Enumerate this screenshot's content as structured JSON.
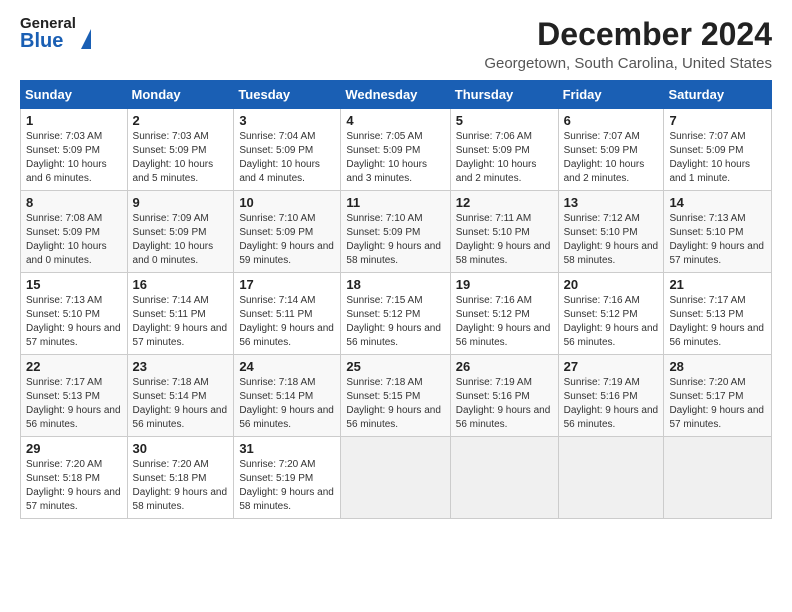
{
  "header": {
    "logo": {
      "general": "General",
      "blue": "Blue"
    },
    "month": "December 2024",
    "location": "Georgetown, South Carolina, United States"
  },
  "weekdays": [
    "Sunday",
    "Monday",
    "Tuesday",
    "Wednesday",
    "Thursday",
    "Friday",
    "Saturday"
  ],
  "weeks": [
    [
      {
        "day": "1",
        "sunrise": "7:03 AM",
        "sunset": "5:09 PM",
        "daylight": "10 hours and 6 minutes."
      },
      {
        "day": "2",
        "sunrise": "7:03 AM",
        "sunset": "5:09 PM",
        "daylight": "10 hours and 5 minutes."
      },
      {
        "day": "3",
        "sunrise": "7:04 AM",
        "sunset": "5:09 PM",
        "daylight": "10 hours and 4 minutes."
      },
      {
        "day": "4",
        "sunrise": "7:05 AM",
        "sunset": "5:09 PM",
        "daylight": "10 hours and 3 minutes."
      },
      {
        "day": "5",
        "sunrise": "7:06 AM",
        "sunset": "5:09 PM",
        "daylight": "10 hours and 2 minutes."
      },
      {
        "day": "6",
        "sunrise": "7:07 AM",
        "sunset": "5:09 PM",
        "daylight": "10 hours and 2 minutes."
      },
      {
        "day": "7",
        "sunrise": "7:07 AM",
        "sunset": "5:09 PM",
        "daylight": "10 hours and 1 minute."
      }
    ],
    [
      {
        "day": "8",
        "sunrise": "7:08 AM",
        "sunset": "5:09 PM",
        "daylight": "10 hours and 0 minutes."
      },
      {
        "day": "9",
        "sunrise": "7:09 AM",
        "sunset": "5:09 PM",
        "daylight": "10 hours and 0 minutes."
      },
      {
        "day": "10",
        "sunrise": "7:10 AM",
        "sunset": "5:09 PM",
        "daylight": "9 hours and 59 minutes."
      },
      {
        "day": "11",
        "sunrise": "7:10 AM",
        "sunset": "5:09 PM",
        "daylight": "9 hours and 58 minutes."
      },
      {
        "day": "12",
        "sunrise": "7:11 AM",
        "sunset": "5:10 PM",
        "daylight": "9 hours and 58 minutes."
      },
      {
        "day": "13",
        "sunrise": "7:12 AM",
        "sunset": "5:10 PM",
        "daylight": "9 hours and 58 minutes."
      },
      {
        "day": "14",
        "sunrise": "7:13 AM",
        "sunset": "5:10 PM",
        "daylight": "9 hours and 57 minutes."
      }
    ],
    [
      {
        "day": "15",
        "sunrise": "7:13 AM",
        "sunset": "5:10 PM",
        "daylight": "9 hours and 57 minutes."
      },
      {
        "day": "16",
        "sunrise": "7:14 AM",
        "sunset": "5:11 PM",
        "daylight": "9 hours and 57 minutes."
      },
      {
        "day": "17",
        "sunrise": "7:14 AM",
        "sunset": "5:11 PM",
        "daylight": "9 hours and 56 minutes."
      },
      {
        "day": "18",
        "sunrise": "7:15 AM",
        "sunset": "5:12 PM",
        "daylight": "9 hours and 56 minutes."
      },
      {
        "day": "19",
        "sunrise": "7:16 AM",
        "sunset": "5:12 PM",
        "daylight": "9 hours and 56 minutes."
      },
      {
        "day": "20",
        "sunrise": "7:16 AM",
        "sunset": "5:12 PM",
        "daylight": "9 hours and 56 minutes."
      },
      {
        "day": "21",
        "sunrise": "7:17 AM",
        "sunset": "5:13 PM",
        "daylight": "9 hours and 56 minutes."
      }
    ],
    [
      {
        "day": "22",
        "sunrise": "7:17 AM",
        "sunset": "5:13 PM",
        "daylight": "9 hours and 56 minutes."
      },
      {
        "day": "23",
        "sunrise": "7:18 AM",
        "sunset": "5:14 PM",
        "daylight": "9 hours and 56 minutes."
      },
      {
        "day": "24",
        "sunrise": "7:18 AM",
        "sunset": "5:14 PM",
        "daylight": "9 hours and 56 minutes."
      },
      {
        "day": "25",
        "sunrise": "7:18 AM",
        "sunset": "5:15 PM",
        "daylight": "9 hours and 56 minutes."
      },
      {
        "day": "26",
        "sunrise": "7:19 AM",
        "sunset": "5:16 PM",
        "daylight": "9 hours and 56 minutes."
      },
      {
        "day": "27",
        "sunrise": "7:19 AM",
        "sunset": "5:16 PM",
        "daylight": "9 hours and 56 minutes."
      },
      {
        "day": "28",
        "sunrise": "7:20 AM",
        "sunset": "5:17 PM",
        "daylight": "9 hours and 57 minutes."
      }
    ],
    [
      {
        "day": "29",
        "sunrise": "7:20 AM",
        "sunset": "5:18 PM",
        "daylight": "9 hours and 57 minutes."
      },
      {
        "day": "30",
        "sunrise": "7:20 AM",
        "sunset": "5:18 PM",
        "daylight": "9 hours and 58 minutes."
      },
      {
        "day": "31",
        "sunrise": "7:20 AM",
        "sunset": "5:19 PM",
        "daylight": "9 hours and 58 minutes."
      },
      null,
      null,
      null,
      null
    ]
  ],
  "labels": {
    "sunrise": "Sunrise:",
    "sunset": "Sunset:",
    "daylight": "Daylight:"
  }
}
